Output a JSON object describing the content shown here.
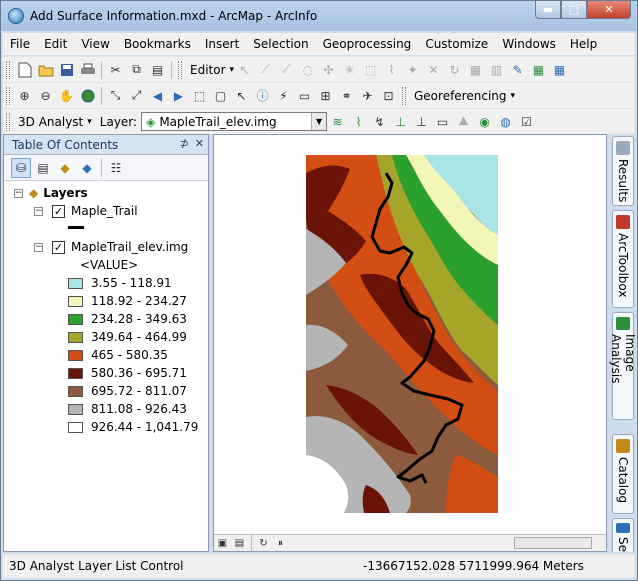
{
  "window": {
    "title": "Add Surface Information.mxd - ArcMap - ArcInfo",
    "min_label": "▬",
    "max_label": "▢",
    "close_label": "✕"
  },
  "menu": [
    "File",
    "Edit",
    "View",
    "Bookmarks",
    "Insert",
    "Selection",
    "Geoprocessing",
    "Customize",
    "Windows",
    "Help"
  ],
  "toolbar1": {
    "editor_label": "Editor",
    "editor_arrow": "▾"
  },
  "toolbar2": {
    "georef_label": "Georeferencing",
    "georef_arrow": "▾"
  },
  "toolbar3": {
    "analyst_label": "3D Analyst",
    "analyst_arrow": "▾",
    "layer_label": "Layer:",
    "layer_value": "MapleTrail_elev.img"
  },
  "toc": {
    "title": "Table Of Contents",
    "pin_icon": "⊅",
    "close_icon": "✕",
    "layers_label": "Layers",
    "trail_label": "Maple_Trail",
    "raster_label": "MapleTrail_elev.img",
    "value_header": "<VALUE>",
    "legend": [
      {
        "label": "3.55 - 118.91",
        "color": "#a8e4e4"
      },
      {
        "label": "118.92 - 234.27",
        "color": "#f2f7b8"
      },
      {
        "label": "234.28 - 349.63",
        "color": "#2ca02c"
      },
      {
        "label": "349.64 - 464.99",
        "color": "#a5a52a"
      },
      {
        "label": "465 - 580.35",
        "color": "#d24e12"
      },
      {
        "label": "580.36 - 695.71",
        "color": "#6a1408"
      },
      {
        "label": "695.72 - 811.07",
        "color": "#8c5a3c"
      },
      {
        "label": "811.08 - 926.43",
        "color": "#b5b5b5"
      },
      {
        "label": "926.44 - 1,041.79",
        "color": "#ffffff"
      }
    ]
  },
  "side_tabs": [
    "Results",
    "ArcToolbox",
    "Image Analysis",
    "Catalog",
    "Se"
  ],
  "status": {
    "left": "3D Analyst Layer List Control",
    "coords": "-13667152.028  5711999.964 Meters"
  }
}
